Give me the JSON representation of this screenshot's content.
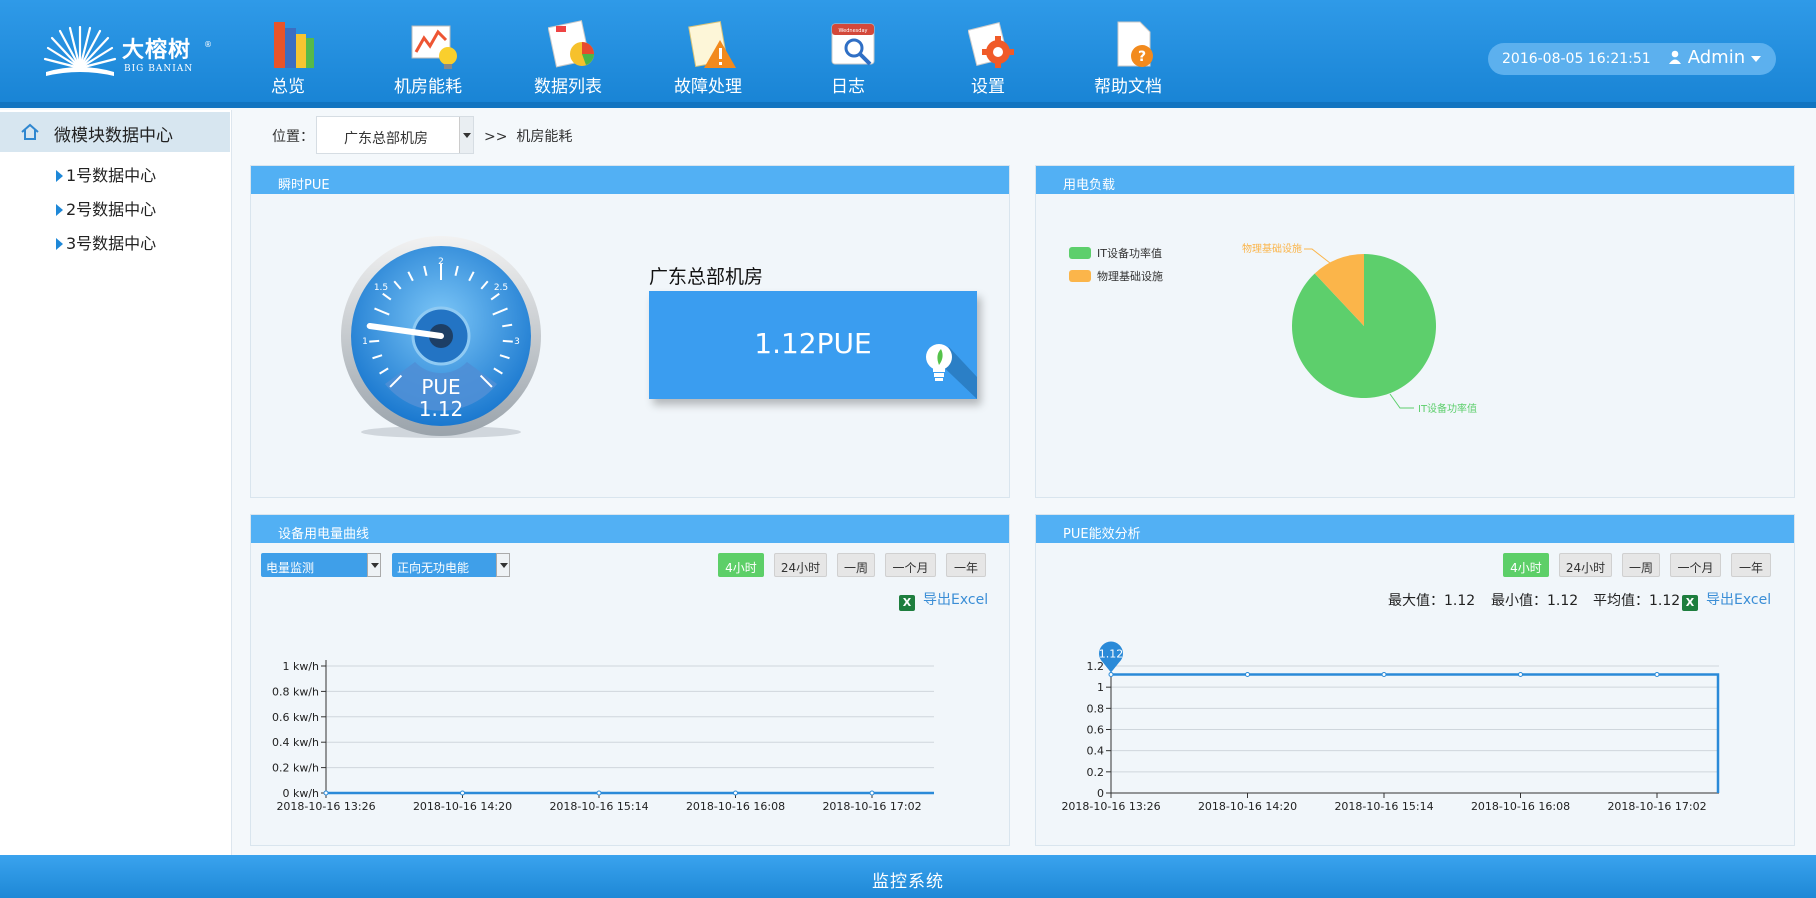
{
  "header": {
    "logo": {
      "cn": "大榕树",
      "en": "BIG BANIAN",
      "mark": "®"
    },
    "nav": [
      {
        "label": "总览",
        "icon": "books-icon"
      },
      {
        "label": "机房能耗",
        "icon": "energy-chart-icon"
      },
      {
        "label": "数据列表",
        "icon": "data-report-icon"
      },
      {
        "label": "故障处理",
        "icon": "warning-icon"
      },
      {
        "label": "日志",
        "icon": "calendar-log-icon"
      },
      {
        "label": "设置",
        "icon": "gear-icon"
      },
      {
        "label": "帮助文档",
        "icon": "help-document-icon"
      }
    ],
    "calendar_word": "Wednesday",
    "datetime": "2016-08-05 16:21:51",
    "user": "Admin"
  },
  "sidebar": {
    "title": "微模块数据中心",
    "items": [
      "1号数据中心",
      "2号数据中心",
      "3号数据中心"
    ]
  },
  "breadcrumb": {
    "label": "位置：",
    "selected": "广东总部机房",
    "separator": ">>",
    "page": "机房能耗"
  },
  "pue_panel": {
    "title": "瞬时PUE",
    "gauge": {
      "label": "PUE",
      "value": "1.12",
      "ticks": [
        "1",
        "1.5",
        "2",
        "2.5",
        "3"
      ],
      "min": 1,
      "max": 3
    },
    "room": "广东总部机房",
    "card_value": "1.12PUE"
  },
  "load_panel": {
    "title": "用电负载",
    "legend": [
      "IT设备功率值",
      "物理基础设施"
    ],
    "colors": {
      "it": "#5dcf6c",
      "infra": "#fbb54a"
    }
  },
  "power_panel": {
    "title": "设备用电量曲线",
    "select1": "电量监测",
    "select2": "正向无功电能",
    "ranges": [
      "4小时",
      "24小时",
      "一周",
      "一个月",
      "一年"
    ],
    "active_range": "4小时",
    "export": "导出Excel"
  },
  "pue_analysis": {
    "title": "PUE能效分析",
    "ranges": [
      "4小时",
      "24小时",
      "一周",
      "一个月",
      "一年"
    ],
    "active_range": "4小时",
    "max": "最大值：1.12",
    "min": "最小值：1.12",
    "avg": "平均值：1.12",
    "export": "导出Excel",
    "marker": "1.12"
  },
  "footer": {
    "text": "监控系统"
  },
  "chart_data": [
    {
      "type": "pie",
      "labels": [
        "IT设备功率值",
        "物理基础设施"
      ],
      "values": [
        88,
        12
      ],
      "colors": [
        "#5dcf6c",
        "#fbb54a"
      ],
      "legend": "top-left"
    },
    {
      "type": "line",
      "x": [
        "2018-10-16 13:26",
        "2018-10-16 14:20",
        "2018-10-16 15:14",
        "2018-10-16 16:08",
        "2018-10-16 17:02"
      ],
      "yticks": [
        "0 kw/h",
        "0.2 kw/h",
        "0.4 kw/h",
        "0.6 kw/h",
        "0.8 kw/h",
        "1 kw/h"
      ],
      "ylim": [
        0,
        1
      ],
      "series": [
        {
          "values": [
            0,
            0,
            0,
            0,
            0
          ]
        }
      ]
    },
    {
      "type": "line",
      "x": [
        "2018-10-16 13:26",
        "2018-10-16 14:20",
        "2018-10-16 15:14",
        "2018-10-16 16:08",
        "2018-10-16 17:02"
      ],
      "yticks": [
        "0",
        "0.2",
        "0.4",
        "0.6",
        "0.8",
        "1",
        "1.2"
      ],
      "ylim": [
        0,
        1.2
      ],
      "series": [
        {
          "values": [
            1.12,
            1.12,
            1.12,
            1.12,
            1.12,
            1.12,
            0
          ]
        }
      ]
    }
  ]
}
